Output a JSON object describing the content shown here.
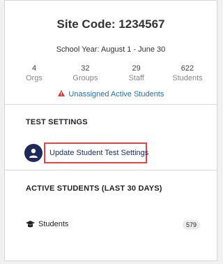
{
  "header": {
    "site_code": "Site Code: 1234567",
    "school_year": "School Year: August 1 - June 30"
  },
  "stats": [
    {
      "value": "4",
      "label": "Orgs"
    },
    {
      "value": "32",
      "label": "Groups"
    },
    {
      "value": "29",
      "label": "Staff"
    },
    {
      "value": "622",
      "label": "Students"
    }
  ],
  "alert": {
    "text": "Unassigned Active Students",
    "icon": "warning-icon"
  },
  "test_settings": {
    "title": "TEST SETTINGS",
    "link_label": "Update Student Test Settings",
    "icon": "user-icon"
  },
  "active_students": {
    "title": "ACTIVE STUDENTS  (LAST 30 DAYS)",
    "rows": [
      {
        "label": "Students",
        "count": "579",
        "icon": "graduation-cap-icon"
      }
    ]
  },
  "colors": {
    "link": "#1f6fb2",
    "alert": "#d9362f",
    "avatar": "#1d2a5a",
    "highlight": "#e0474c"
  }
}
